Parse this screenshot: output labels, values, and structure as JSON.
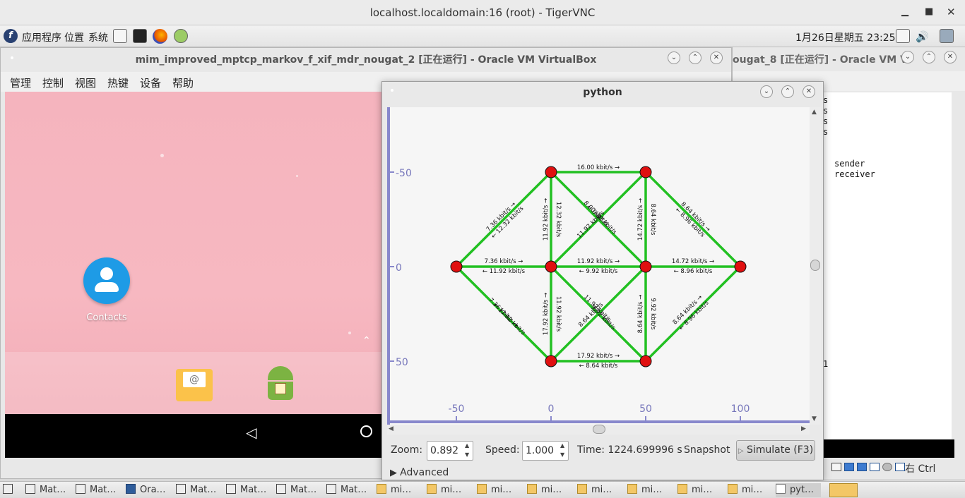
{
  "vnc": {
    "title": "localhost.localdomain:16 (root) - TigerVNC"
  },
  "panel": {
    "menus": [
      "应用程序",
      "位置",
      "系统"
    ],
    "clock": "1月26日星期五 23:25"
  },
  "vbox": {
    "title": "mim_improved_mptcp_markov_f_xif_mdr_nougat_2 [正在运行] - Oracle VM VirtualBox",
    "menu": [
      "管理",
      "控制",
      "视图",
      "热键",
      "设备",
      "帮助"
    ],
    "contacts_label": "Contacts",
    "right_ctrl": "右 Ctrl"
  },
  "vbox2": {
    "title": "ougat_8 [正在运行] - Oracle VM V",
    "term_lines": [
      "s",
      "s",
      "s",
      "s",
      "",
      "",
      "sender",
      "receiver"
    ],
    "term_bottom_char": "1"
  },
  "python": {
    "title": "python",
    "zoom_label": "Zoom:",
    "zoom_value": "0.892",
    "speed_label": "Speed:",
    "speed_value": "1.000",
    "time_text": "Time: 1224.699996 s",
    "snapshot_label": "Snapshot",
    "simulate_label": "Simulate (F3)",
    "advanced_label": "Advanced",
    "axis_x_ticks": [
      "-50",
      "0",
      "50",
      "100"
    ],
    "axis_y_ticks": [
      "-50",
      "0",
      "50"
    ],
    "link_labels": {
      "top_h_1": "16.00 kbit/s →",
      "mid_lh_1": "7.36 kbit/s →",
      "mid_lh_2": "← 11.92 kbit/s",
      "mid_ch_1": "11.92 kbit/s →",
      "mid_ch_2": "← 9.92 kbit/s",
      "mid_rh_1": "14.72 kbit/s →",
      "mid_rh_2": "← 8.96 kbit/s",
      "bot_h_1": "17.92 kbit/s →",
      "bot_h_2": "← 8.64 kbit/s",
      "ul_d_1": "7.36 kbit/s →",
      "ul_d_2": "← 12.32 kbit/s",
      "ur_d_1": "8.64 kbit/s →",
      "ur_d_2": "← 8.96 kbit/s",
      "ll_d_1": "7.36 kbit/s →",
      "ll_d_2": "← 17.92 kbit/s",
      "lr_d_1": "8.64 kbit/s →",
      "lr_d_2": "← 8.96 kbit/s",
      "v_left_top_1": "11.92 kbit/s →",
      "v_left_top_2": "12.32 kbit/s",
      "v_right_top_1": "14.72 kbit/s →",
      "v_right_top_2": "8.64 kbit/s",
      "v_left_bot_1": "17.92 kbit/s →",
      "v_left_bot_2": "11.92 kbit/s",
      "v_right_bot_1": "8.64 kbit/s →",
      "v_right_bot_2": "9.92 kbit/s",
      "x_top_1": "8.00 kbit/s",
      "x_top_2": "← 9.92 kbit/s",
      "x_top_3": "11.92 kbit/s",
      "x_bot_1": "11.92 kbit/s",
      "x_bot_2": "8.64 kbit/s",
      "x_bot_3": "9.92 kbit/s"
    }
  },
  "taskbar": {
    "items": [
      "Mat…",
      "Mat…",
      "Ora…",
      "Mat…",
      "Mat…",
      "Mat…",
      "Mat…",
      "mi…",
      "mi…",
      "mi…",
      "mi…",
      "mi…",
      "mi…",
      "mi…",
      "pyt…"
    ]
  }
}
